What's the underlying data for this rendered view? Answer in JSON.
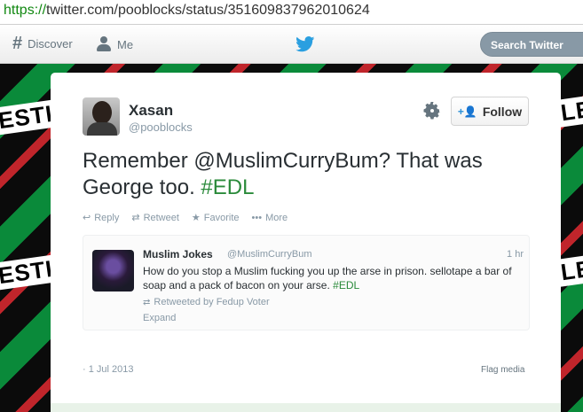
{
  "browser": {
    "url_protocol": "https://",
    "url_rest": "twitter.com/pooblocks/status/351609837962010624"
  },
  "nav": {
    "discover_label": "Discover",
    "me_label": "Me",
    "search_placeholder": "Search Twitter"
  },
  "background": {
    "banner_left_text": "ESTI",
    "banner_right_text": "LE"
  },
  "tweet": {
    "author_name": "Xasan",
    "author_handle": "@pooblocks",
    "follow_label": "Follow",
    "text_main": "Remember @MuslimCurryBum? That was George too. ",
    "hashtag": "#EDL",
    "actions": {
      "reply": "Reply",
      "retweet": "Retweet",
      "favorite": "Favorite",
      "more": "More"
    },
    "date": "· 1 Jul 2013",
    "flag_label": "Flag media"
  },
  "embedded_tweet": {
    "author_name": "Muslim Jokes",
    "author_handle": "@MuslimCurryBum",
    "time": "1 hr",
    "text_main": "How do you stop a Muslim fucking you up the arse in prison. sellotape a bar of soap and a pack of bacon on your arse. ",
    "hashtag": "#EDL",
    "retweeted_by": "Retweeted by Fedup Voter",
    "expand_label": "Expand"
  },
  "colors": {
    "link_green": "#2a8a3a",
    "twitter_blue": "#2a8fd6",
    "muted_gray": "#8899a6"
  }
}
